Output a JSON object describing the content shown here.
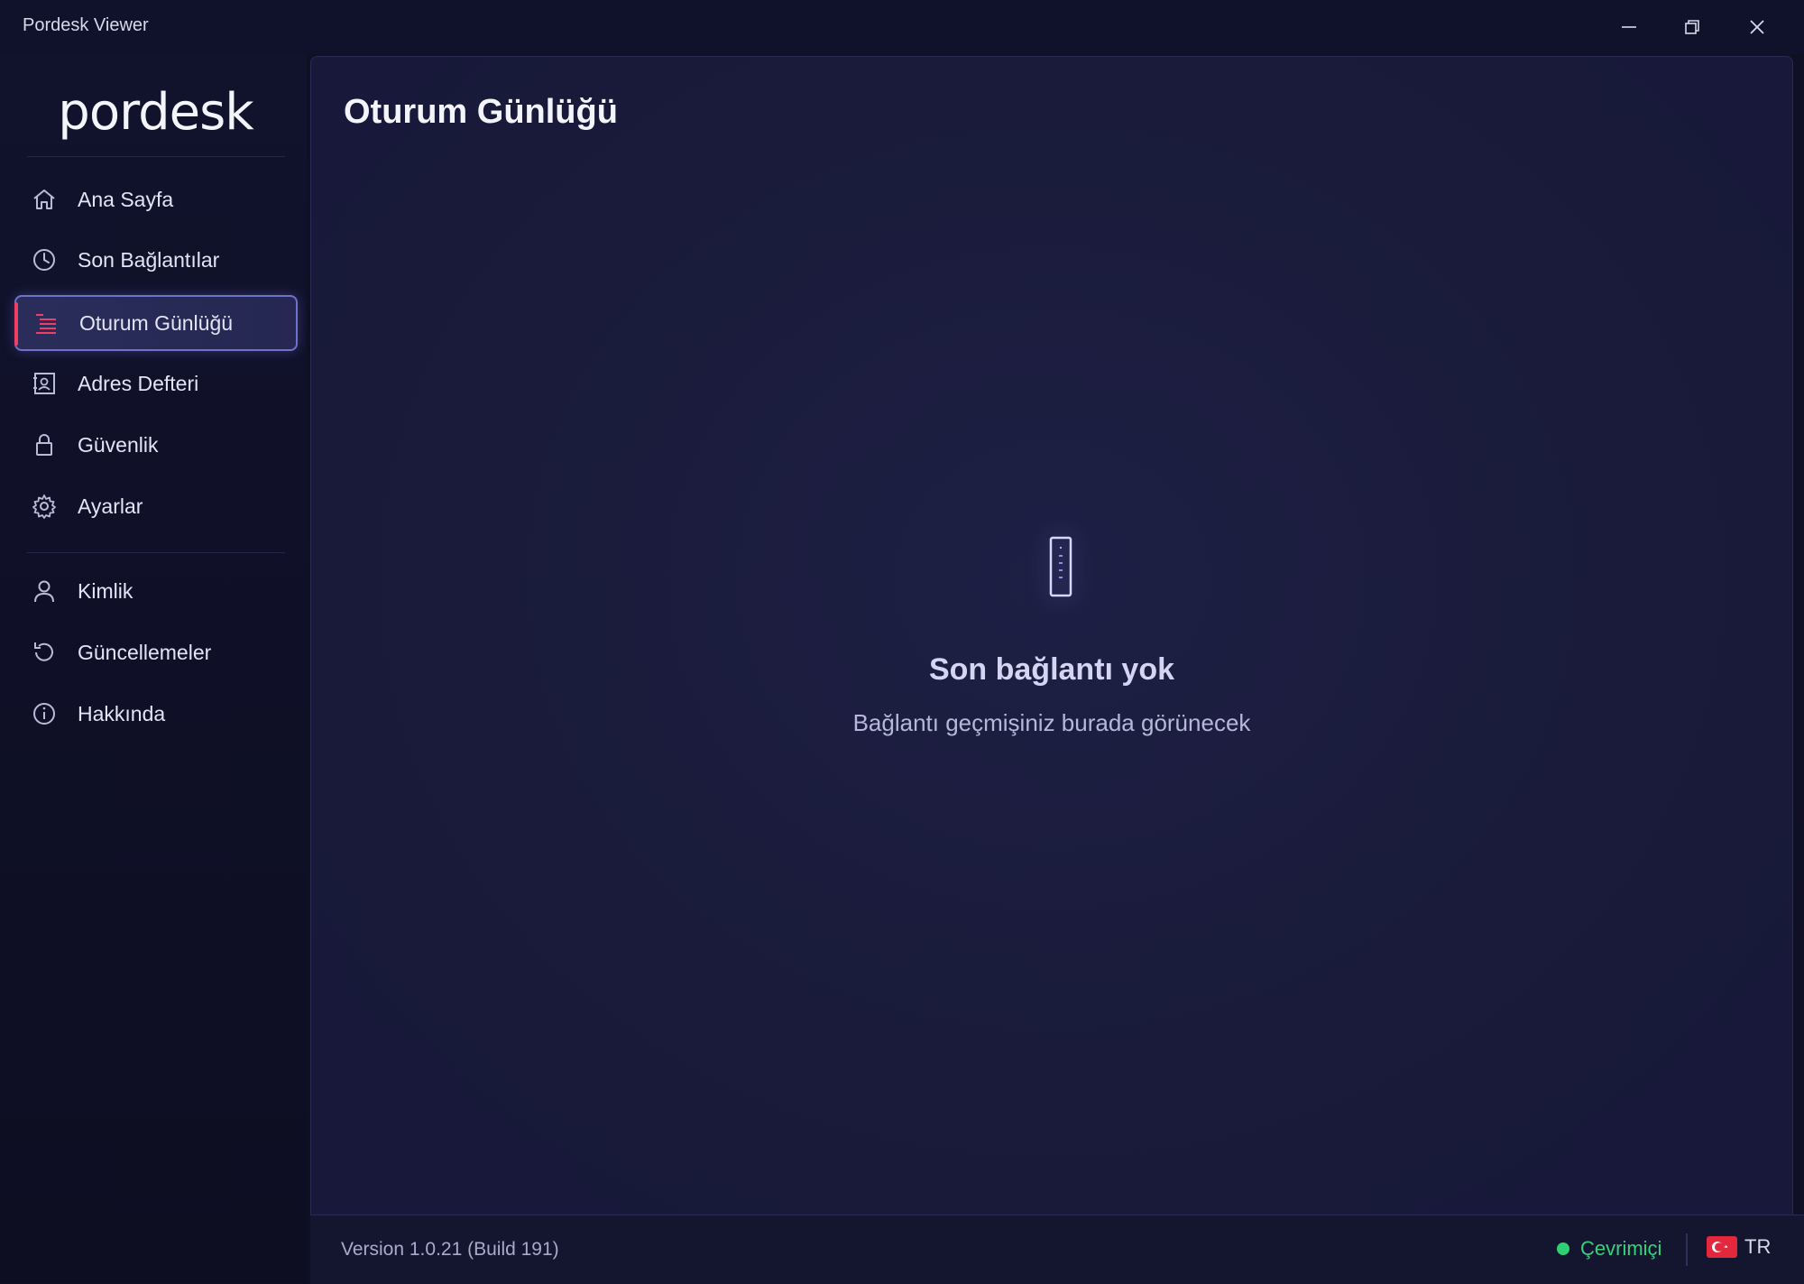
{
  "window": {
    "title": "Pordesk Viewer"
  },
  "sidebar": {
    "logo": "pordesk",
    "items": [
      {
        "label": "Ana Sayfa",
        "icon": "home-icon"
      },
      {
        "label": "Son Bağlantılar",
        "icon": "clock-icon"
      },
      {
        "label": "Oturum Günlüğü",
        "icon": "list-icon",
        "active": true
      },
      {
        "label": "Adres Defteri",
        "icon": "address-book-icon"
      },
      {
        "label": "Güvenlik",
        "icon": "lock-icon"
      },
      {
        "label": "Ayarlar",
        "icon": "gear-icon"
      }
    ],
    "secondary_items": [
      {
        "label": "Kimlik",
        "icon": "user-icon"
      },
      {
        "label": "Güncellemeler",
        "icon": "refresh-icon"
      },
      {
        "label": "Hakkında",
        "icon": "info-icon"
      }
    ]
  },
  "main": {
    "title": "Oturum Günlüğü",
    "empty_state": {
      "icon": "session-log-icon",
      "title": "Son bağlantı yok",
      "subtitle": "Bağlantı geçmişiniz burada görünecek"
    }
  },
  "footer": {
    "version": "Version 1.0.21 (Build 191)",
    "status": "Çevrimiçi",
    "language": "TR"
  },
  "colors": {
    "accent": "#ef3f63",
    "online": "#2fcf74",
    "active_border": "#6f72c9"
  }
}
